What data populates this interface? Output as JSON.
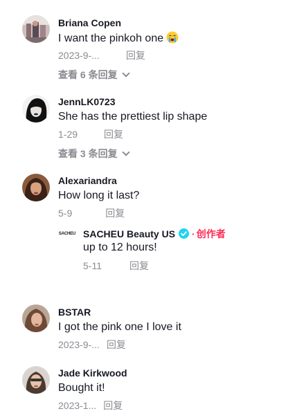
{
  "comments": [
    {
      "username": "Briana Copen",
      "text": "I want the pinkoh one",
      "emoji_icon": "crying-face-icon",
      "date": "2023-9-...",
      "reply_label": "回复",
      "view_replies": "查看 6 条回复"
    },
    {
      "username": "JennLK0723",
      "text": "She has the prettiest lip shape",
      "date": "1-29",
      "reply_label": "回复",
      "view_replies": "查看 3 条回复"
    },
    {
      "username": "Alexariandra",
      "text": "How long it last?",
      "date": "5-9",
      "reply_label": "回复",
      "reply": {
        "avatar_text": "SACHEU",
        "username": "SACHEU Beauty US",
        "creator_label": "创作者",
        "text": "up to 12 hours!",
        "date": "5-11",
        "reply_label": "回复"
      }
    },
    {
      "username": "BSTAR",
      "text": "I got the pink one I love it",
      "date": "2023-9-...",
      "reply_label": "回复"
    },
    {
      "username": "Jade Kirkwood",
      "text": "Bought it!",
      "date": "2023-1...",
      "reply_label": "回复"
    }
  ],
  "colors": {
    "text": "#161823",
    "muted": "#8a8b91",
    "creator": "#fe2c55",
    "verified": "#20d5ec"
  }
}
